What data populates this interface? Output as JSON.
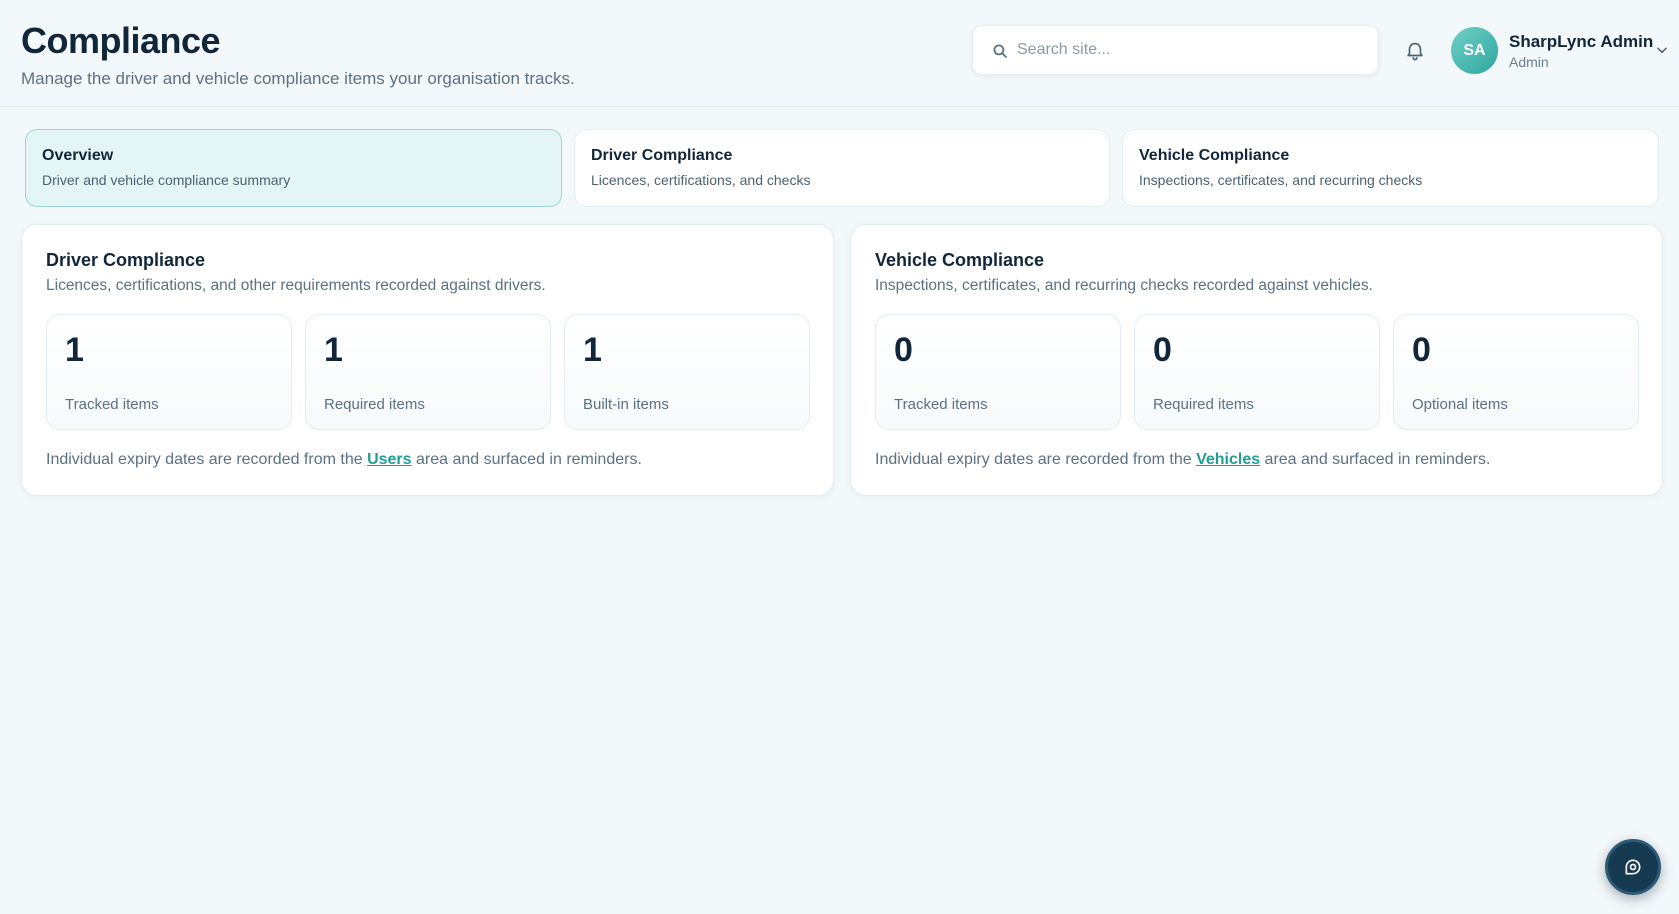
{
  "header": {
    "title": "Compliance",
    "subtitle": "Manage the driver and vehicle compliance items your organisation tracks.",
    "search_placeholder": "Search site...",
    "user": {
      "initials": "SA",
      "name": "SharpLync Admin",
      "role": "Admin"
    }
  },
  "tabs": [
    {
      "title": "Overview",
      "desc": "Driver and vehicle compliance summary"
    },
    {
      "title": "Driver Compliance",
      "desc": "Licences, certifications, and checks"
    },
    {
      "title": "Vehicle Compliance",
      "desc": "Inspections, certificates, and recurring checks"
    }
  ],
  "driver_card": {
    "title": "Driver Compliance",
    "desc": "Licences, certifications, and other requirements recorded against drivers.",
    "stats": [
      {
        "value": "1",
        "label": "Tracked items"
      },
      {
        "value": "1",
        "label": "Required items"
      },
      {
        "value": "1",
        "label": "Built-in items"
      }
    ],
    "footer_before": "Individual expiry dates are recorded from the ",
    "footer_link": "Users",
    "footer_after": " area and surfaced in reminders."
  },
  "vehicle_card": {
    "title": "Vehicle Compliance",
    "desc": "Inspections, certificates, and recurring checks recorded against vehicles.",
    "stats": [
      {
        "value": "0",
        "label": "Tracked items"
      },
      {
        "value": "0",
        "label": "Required items"
      },
      {
        "value": "0",
        "label": "Optional items"
      }
    ],
    "footer_before": "Individual expiry dates are recorded from the ",
    "footer_link": "Vehicles",
    "footer_after": " area and surfaced in reminders."
  },
  "colors": {
    "accent": "#1f9e96",
    "text": "#12263a",
    "background": "#f3f8fa"
  }
}
